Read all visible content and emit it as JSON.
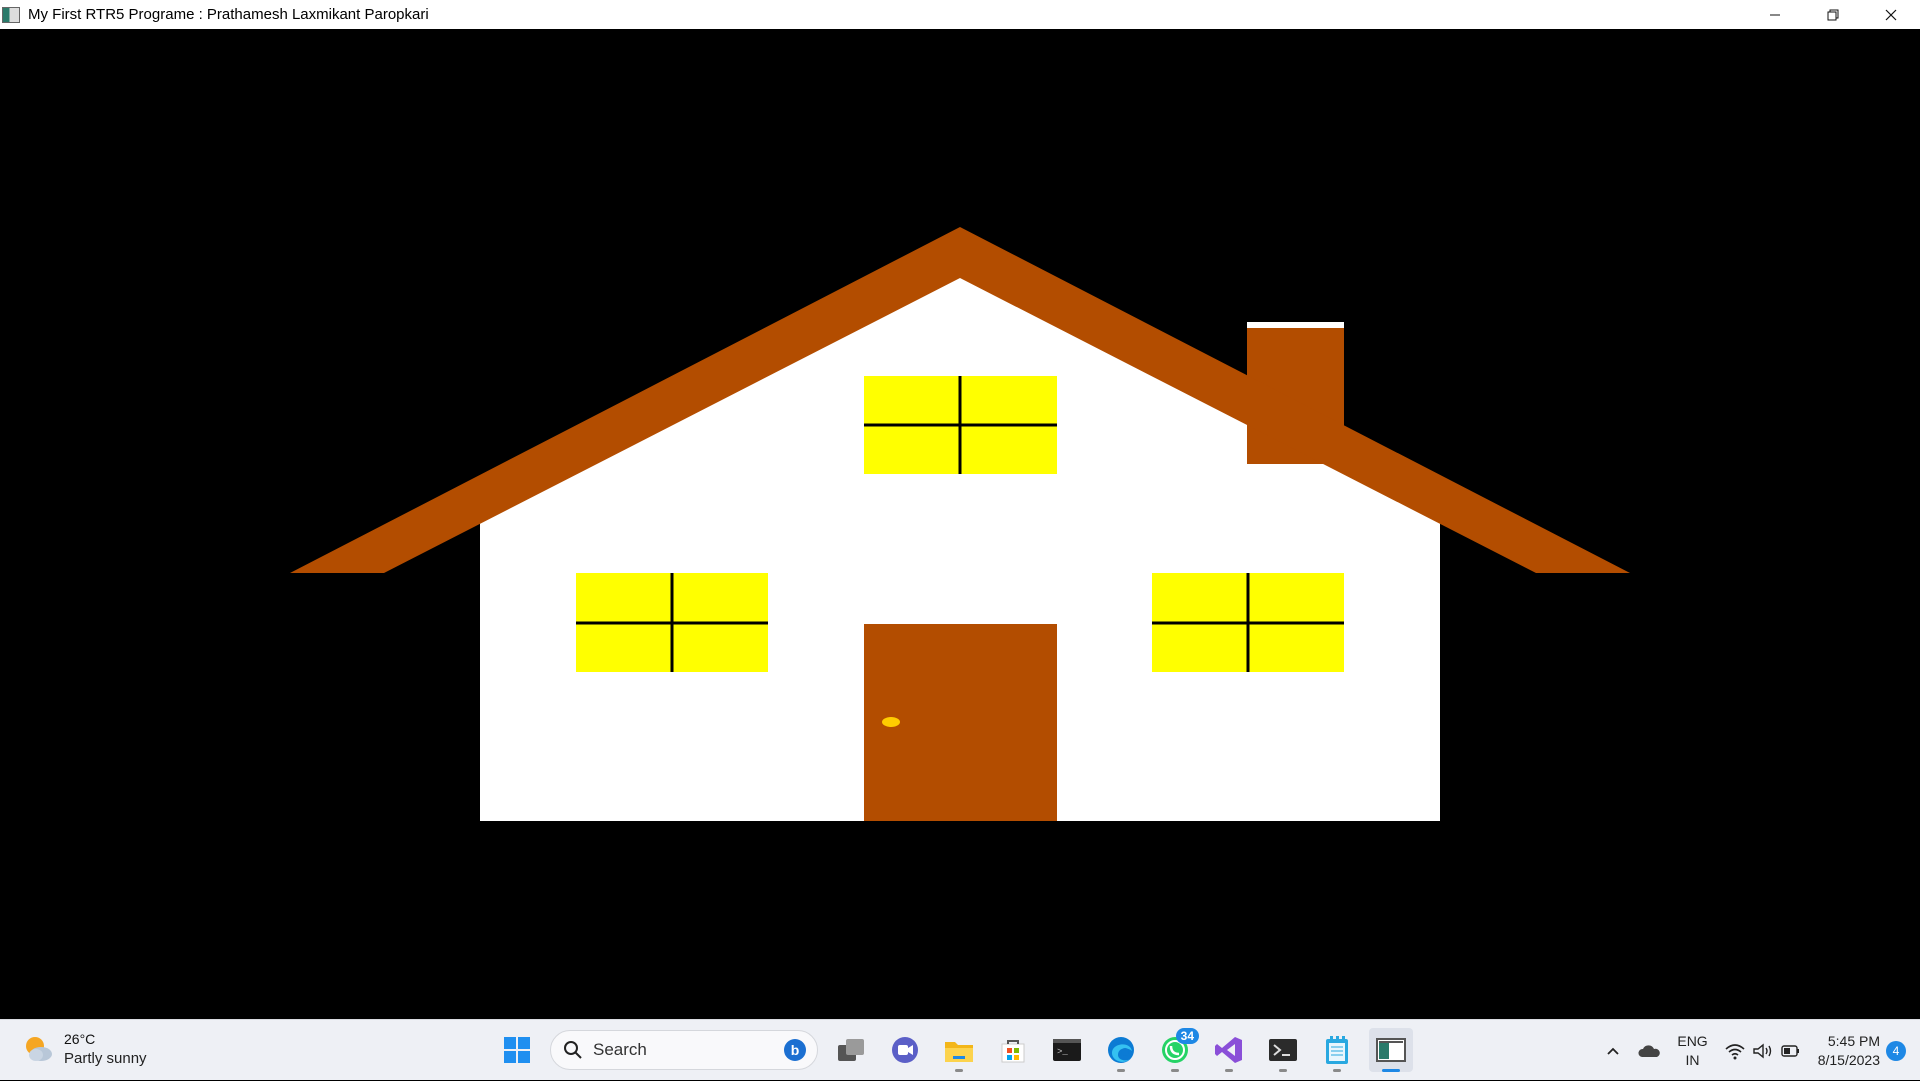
{
  "window": {
    "title": "My First RTR5 Programe : Prathamesh Laxmikant Paropkari",
    "controls": [
      "minimize",
      "restore",
      "close"
    ]
  },
  "scene": {
    "background": "#000000",
    "colors": {
      "roof": "#B34D00",
      "wall": "#FFFFFF",
      "window": "#FFFF00",
      "window_frame": "#000000",
      "door": "#B34D00",
      "door_knob": "#FFCC00",
      "chimney": "#B34D00",
      "chimney_cap": "#FFFFFF"
    },
    "windows": 3,
    "doors": 1
  },
  "taskbar": {
    "weather": {
      "temp": "26°C",
      "condition": "Partly sunny",
      "icon": "partly-sunny-icon"
    },
    "search": {
      "placeholder": "Search"
    },
    "apps": [
      {
        "name": "start-icon"
      },
      {
        "name": "task-view-icon"
      },
      {
        "name": "teams-chat-icon"
      },
      {
        "name": "file-explorer-icon"
      },
      {
        "name": "microsoft-store-icon"
      },
      {
        "name": "terminal-icon"
      },
      {
        "name": "edge-icon"
      },
      {
        "name": "whatsapp-icon",
        "badge": "34"
      },
      {
        "name": "visual-studio-icon"
      },
      {
        "name": "developer-prompt-icon"
      },
      {
        "name": "notepad-icon"
      },
      {
        "name": "rtr5-app-icon",
        "active": true
      }
    ],
    "tray": {
      "lang_line1": "ENG",
      "lang_line2": "IN",
      "time": "5:45 PM",
      "date": "8/15/2023",
      "notifications": "4"
    }
  }
}
